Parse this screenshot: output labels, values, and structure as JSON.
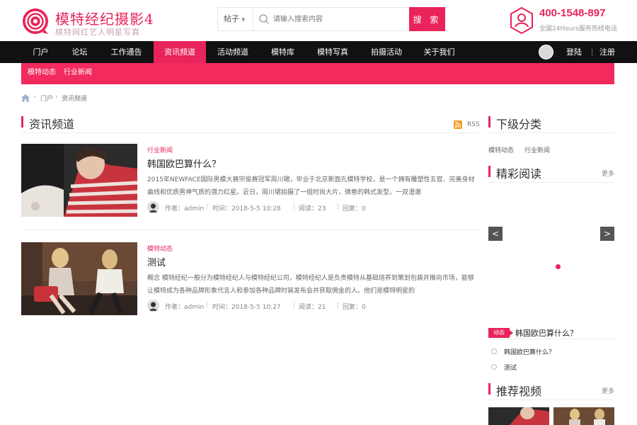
{
  "header": {
    "logo_title": "模特经纪摄影4",
    "logo_subtitle": "棋特网红艺人明星写真",
    "search": {
      "type_label": "帖子",
      "placeholder": "请输入搜索内容",
      "button_label": "搜 索"
    },
    "hotline": {
      "number": "400-1548-897",
      "label": "全国24Hours服务热线电话"
    }
  },
  "nav": {
    "items": [
      "门户",
      "论坛",
      "工作通告",
      "资讯频道",
      "活动频道",
      "模特库",
      "模特写真",
      "拍摄活动",
      "关于我们"
    ],
    "active_index": 3,
    "login": "登陆",
    "register": "注册"
  },
  "subnav": {
    "items": [
      "模特动态",
      "行业新闻"
    ]
  },
  "breadcrumb": {
    "items": [
      "门户",
      "资讯频道"
    ]
  },
  "main": {
    "section_title": "资讯频道",
    "rss_label": "RSS",
    "articles": [
      {
        "category": "行业新闻",
        "title": "韩国欧巴算什么？",
        "summary": "2015年NEWFACE国际男模大赛宗俊赛冠军周川珺，毕业于北京新面孔模特学校，是一个拥有雕塑性五官、完美身材曲线和优质男神气质的潜力红星。近日，周川珺拍摄了一组时尚大片，微卷的韩式发型，一双澄澈",
        "author": "作者：admin",
        "time": "时间：2018-5-5 10:28",
        "views": "阅读：23",
        "replies": "回复：0"
      },
      {
        "category": "模特动态",
        "title": "测试",
        "summary": "概念 模特经纪一般分为模特经纪人与模特经纪公司，模特经纪人是负责模特从基础培养到策划包装并推向市场，能够让模特成为各种品牌形象代言人和参加各种品牌时装发布会并获取佣金的人。他们是模特明星的",
        "author": "作者：admin",
        "time": "时间：2018-5-5 10:27",
        "views": "阅读：21",
        "replies": "回复：0"
      }
    ]
  },
  "sidebar": {
    "subcats_title": "下级分类",
    "subcats": [
      "模特动态",
      "行业新闻"
    ],
    "featured_title": "精彩阅读",
    "featured_more": "更多",
    "slider_prev": "<",
    "slider_next": ">",
    "dynamic_badge": "动态",
    "dynamic_title": "韩国欧巴算什么？",
    "hot_items": [
      "韩国欧巴算什么？",
      "测试"
    ],
    "video_title": "推荐视频",
    "video_more": "更多"
  },
  "colors": {
    "accent": "#e8245a",
    "nav_bg": "#111111",
    "subnav_bg": "#f22a5d"
  },
  "icons": [
    "logo-swirl-icon",
    "search-icon",
    "hotline-user-icon",
    "home-icon",
    "rss-icon"
  ]
}
